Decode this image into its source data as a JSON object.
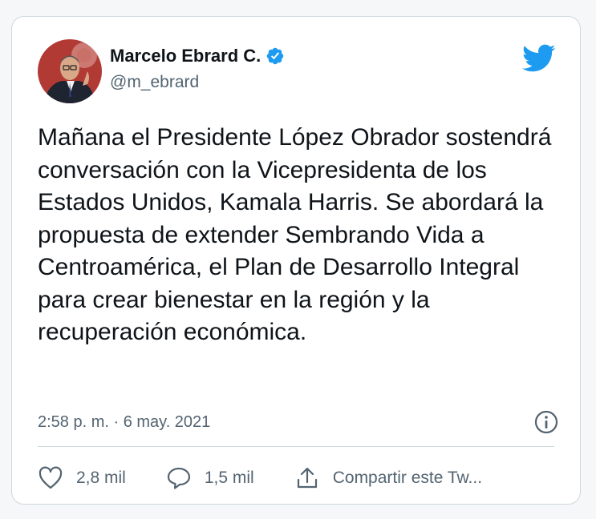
{
  "tweet": {
    "author": {
      "name": "Marcelo Ebrard C.",
      "handle": "@m_ebrard",
      "verified": true,
      "avatar_icon": "avatar-photo"
    },
    "text": "Mañana el Presidente López Obrador sostendrá conversación con la Vicepresidenta de los Estados Unidos, Kamala Harris. Se abordará la propuesta de extender Sembrando Vida a Centroamérica, el Plan de Desarrollo Integral para crear bienestar en la región y la recuperación económica.",
    "timestamp": "2:58 p. m. · 6 may. 2021",
    "actions": {
      "likes": "2,8 mil",
      "replies": "1,5 mil",
      "share_label": "Compartir este Tw..."
    }
  },
  "colors": {
    "brand_blue": "#1d9bf0",
    "text_primary": "#0f1419",
    "text_secondary": "#536471",
    "divider": "#cfd9de"
  },
  "icons": {
    "logo": "twitter-bird-icon",
    "verified": "verified-badge-icon",
    "info": "info-icon",
    "like": "heart-icon",
    "reply": "speech-bubble-icon",
    "share": "share-icon"
  }
}
